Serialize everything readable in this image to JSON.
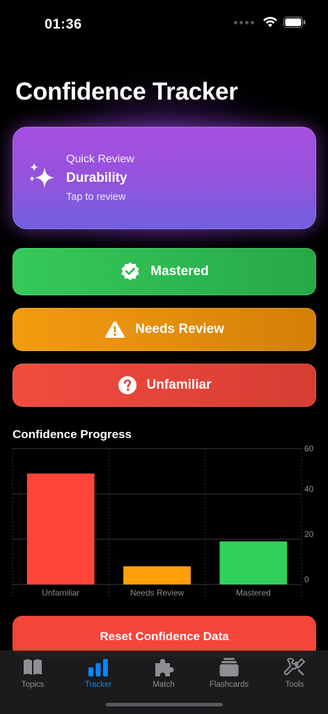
{
  "status": {
    "time": "01:36"
  },
  "header": {
    "title": "Confidence Tracker"
  },
  "quick_review": {
    "kicker": "Quick Review",
    "topic": "Durability",
    "hint": "Tap to review"
  },
  "buttons": {
    "mastered": "Mastered",
    "needs_review": "Needs Review",
    "unfamiliar": "Unfamiliar",
    "reset": "Reset Confidence Data"
  },
  "colors": {
    "mastered": "#30d158",
    "needs_review": "#ff9f0a",
    "unfamiliar": "#ff453a",
    "accent": "#0a84ff"
  },
  "chart_title": "Confidence Progress",
  "chart_data": {
    "type": "bar",
    "categories": [
      "Unfamiliar",
      "Needs Review",
      "Mastered"
    ],
    "values": [
      49,
      8,
      19
    ],
    "colors": [
      "#ff453a",
      "#ff9f0a",
      "#30d158"
    ],
    "ylim": [
      0,
      60
    ],
    "yticks": [
      0,
      20,
      40,
      60
    ],
    "grid": true,
    "y_axis_side": "right"
  },
  "tabs": [
    {
      "label": "Topics",
      "icon": "book-icon",
      "active": false
    },
    {
      "label": "Tracker",
      "icon": "bar-chart-icon",
      "active": true
    },
    {
      "label": "Match",
      "icon": "puzzle-icon",
      "active": false
    },
    {
      "label": "Flashcards",
      "icon": "cards-icon",
      "active": false
    },
    {
      "label": "Tools",
      "icon": "wrench-screwdriver-icon",
      "active": false
    }
  ]
}
